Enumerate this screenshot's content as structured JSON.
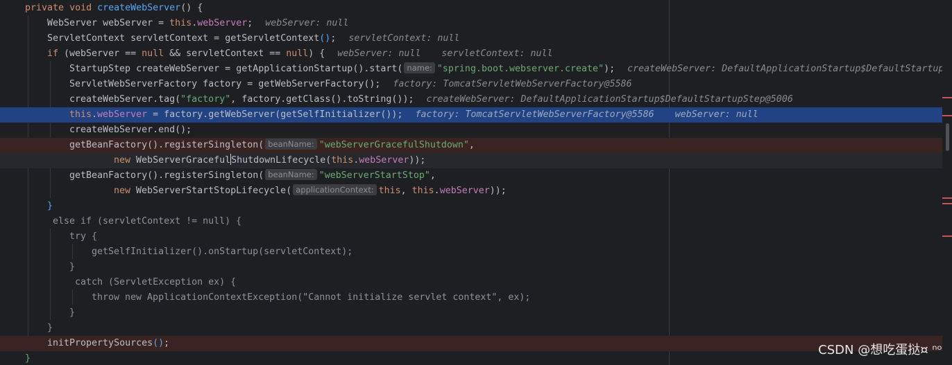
{
  "tokens": {
    "private": "private",
    "void": "void",
    "createWebServerFn": "createWebServer",
    "parens_brace": "() {",
    "WebServer": "WebServer",
    "webServer": "webServer",
    "eq": " = ",
    "this": "this",
    "dot": ".",
    "semi": ";",
    "ServletContext": "ServletContext",
    "servletContext": "servletContext",
    "getServletContext": "getServletContext",
    "callEnd": "()",
    "if": "if",
    "ifCond1": " (webServer == ",
    "null": "null",
    "ifCond2": " && servletContext == ",
    "ifCond3": ") {",
    "StartupStep": "StartupStep",
    "createWebServer": "createWebServer",
    "getApplicationStartup": "getApplicationStartup",
    "start": "start",
    "openParen": "(",
    "closeParen": ")",
    "callParen": "()",
    "ServletWebServerFactory": "ServletWebServerFactory",
    "factory": "factory",
    "getWebServerFactory": "getWebServerFactory",
    "tag": "tag",
    "comma": ", ",
    "getClass": "getClass",
    "toString": "toString",
    "getWebServer": "getWebServer",
    "getSelfInitializer": "getSelfInitializer",
    "end": "end",
    "getBeanFactory": "getBeanFactory",
    "registerSingleton": "registerSingleton",
    "new": "new",
    "WebServerGracefulShutdownLifecycle1": "WebServerGraceful",
    "WebServerGracefulShutdownLifecycle2": "ShutdownLifecycle",
    "WebServerStartStopLifecycle": "WebServerStartStopLifecycle",
    "closeBrace": "}",
    "elseIf": " else if (servletContext != null) {",
    "try": "try {",
    "onStartupLine": "getSelfInitializer().onStartup(servletContext);",
    "closeBraceSolo": "}",
    "catchLine": " catch (ServletException ex) {",
    "throwLine": "throw new ApplicationContextException(\"Cannot initialize servlet context\", ex);",
    "initPropertySources": "initPropertySources"
  },
  "strings": {
    "springBoot": "\"spring.boot.webserver.create\"",
    "factoryStr": "\"factory\"",
    "gracefulShutdown": "\"webServerGracefulShutdown\"",
    "startStop": "\"webServerStartStop\""
  },
  "hints": {
    "name": "name:",
    "beanName": "beanName:",
    "applicationContext": "applicationContext:"
  },
  "inline_values": {
    "webServerNull": "webServer: null",
    "servletContextNull": "servletContext: null",
    "createWebServerVal": "createWebServer: DefaultApplicationStartup$DefaultStartupStep@5006",
    "factoryVal": "factory: TomcatServletWebServerFactory@5586",
    "createWebServerValTrunc": "createWebServer: DefaultApplicationStartup$DefaultStartupSt"
  },
  "watermark": "CSDN @想吃蛋挞¤ ⁿᵒ",
  "colors": {
    "background": "#1e1f22",
    "execution_line": "#214283",
    "breakpoint_line": "#3a2323",
    "keyword": "#cf8e6d",
    "method": "#56a8f5",
    "field": "#c77dbb",
    "string": "#6aab73"
  }
}
